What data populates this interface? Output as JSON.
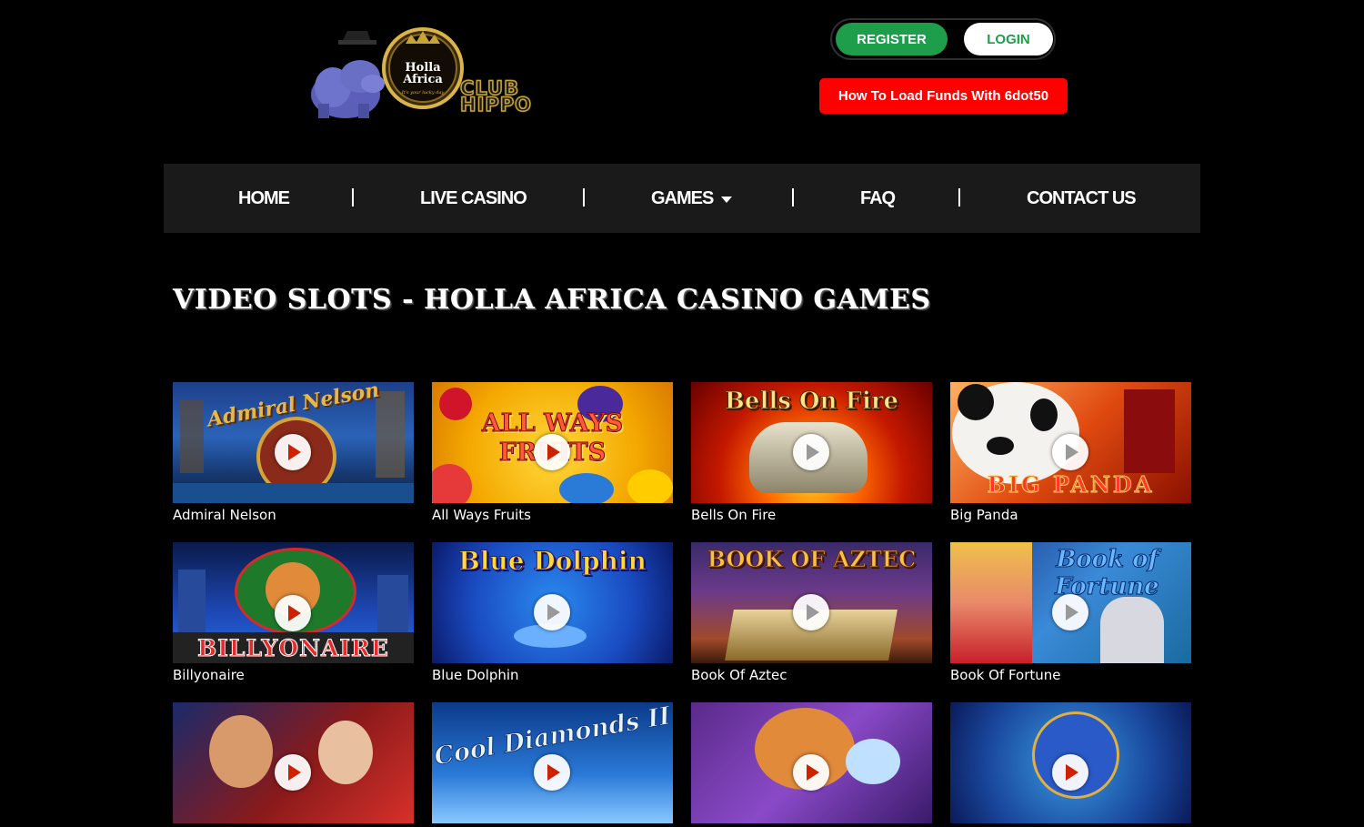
{
  "logo": {
    "emblem_line1": "Holla",
    "emblem_line2": "Africa",
    "emblem_tagline": "It's your lucky day",
    "word_line1": "CLUB",
    "word_line2": "HIPPO"
  },
  "auth": {
    "register_label": "REGISTER",
    "login_label": "LOGIN"
  },
  "funds_button": "How To Load Funds With 6dot50",
  "nav": {
    "home": "HOME",
    "live_casino": "LIVE CASINO",
    "games": "GAMES",
    "faq": "FAQ",
    "contact": "CONTACT US"
  },
  "page_title": "VIDEO SLOTS - HOLLA AFRICA CASINO GAMES",
  "games": [
    {
      "title": "Admiral Nelson",
      "art": "Admiral Nelson"
    },
    {
      "title": "All Ways Fruits",
      "art": "ALL WAYS FRUITS"
    },
    {
      "title": "Bells On Fire",
      "art": "Bells On Fire"
    },
    {
      "title": "Big Panda",
      "art": "BIG PANDA"
    },
    {
      "title": "Billyonaire",
      "art": "BILLYONAIRE"
    },
    {
      "title": "Blue Dolphin",
      "art": "Blue Dolphin"
    },
    {
      "title": "Book Of Aztec",
      "art": "BOOK OF AZTEC"
    },
    {
      "title": "Book Of Fortune",
      "art": "Book of Fortune"
    },
    {
      "title": "",
      "art": ""
    },
    {
      "title": "",
      "art": "Cool Diamonds II"
    },
    {
      "title": "",
      "art": ""
    },
    {
      "title": "",
      "art": ""
    }
  ],
  "colors": {
    "register_green": "#1e9e4a",
    "funds_red": "#ff0000",
    "nav_bg": "#1a1a1a",
    "logo_gold": "#c8a335"
  }
}
